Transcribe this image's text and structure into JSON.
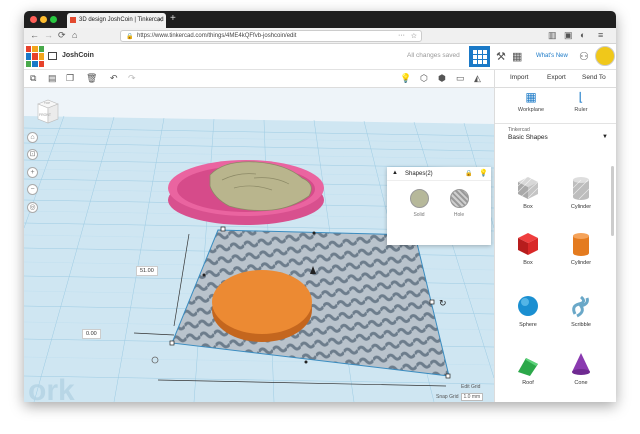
{
  "browser": {
    "tab_title": "3D design JoshCoin | Tinkercad",
    "tab_close": "✕",
    "new_tab": "+",
    "url": "https://www.tinkercad.com/things/4ME4kQFfvb-joshcoin/edit",
    "back": "←",
    "forward": "→",
    "reload": "⟳",
    "home": "⌂",
    "menu_dots": "···",
    "star": "☆"
  },
  "app": {
    "logo_letters": [
      "T",
      "I",
      "N",
      "K",
      "E",
      "R",
      "C",
      "A",
      "D"
    ],
    "logo_colors": [
      "#e7412b",
      "#f2a51c",
      "#48a94a",
      "#1a79c7",
      "#e7412b",
      "#f2a51c",
      "#48a94a",
      "#1a79c7",
      "#e7412b"
    ],
    "project_name": "JoshCoin",
    "save_status": "All changes saved",
    "whats_new": "What's New",
    "accent": "#1a79c7"
  },
  "toolbar": {
    "import": "Import",
    "export": "Export",
    "send_to": "Send To"
  },
  "inspector": {
    "title": "Shapes(2)",
    "solid": "Solid",
    "hole": "Hole"
  },
  "panel": {
    "workplane": "Workplane",
    "ruler": "Ruler",
    "library_label": "Tinkercad",
    "library_value": "Basic Shapes",
    "shapes": [
      {
        "label": "Box",
        "icon": "box-hole-icon"
      },
      {
        "label": "Cylinder",
        "icon": "cylinder-hole-icon"
      },
      {
        "label": "Box",
        "icon": "box-icon"
      },
      {
        "label": "Cylinder",
        "icon": "cylinder-icon"
      },
      {
        "label": "Sphere",
        "icon": "sphere-icon"
      },
      {
        "label": "Scribble",
        "icon": "scribble-icon"
      },
      {
        "label": "Roof",
        "icon": "roof-icon"
      },
      {
        "label": "Cone",
        "icon": "cone-icon"
      }
    ]
  },
  "viewport": {
    "viewcube_top": "TOP",
    "viewcube_front": "FRONT",
    "dim_height": "51.00",
    "dim_offset": "0.00",
    "edit_grid": "Edit Grid",
    "snap_grid": "Snap Grid",
    "snap_value": "1.0 mm"
  }
}
